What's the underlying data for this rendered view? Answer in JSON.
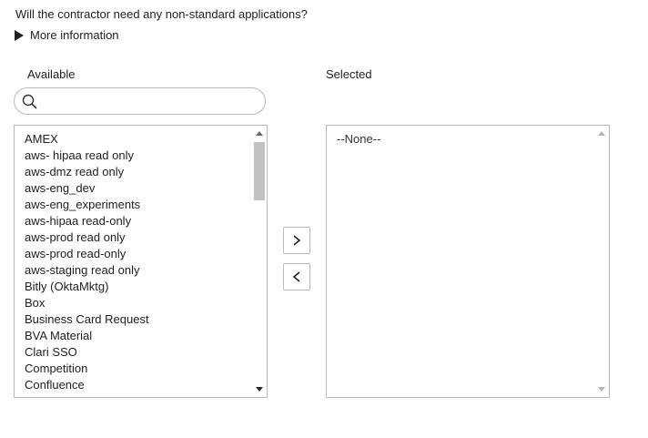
{
  "question": "Will the contractor need any non-standard applications?",
  "more_info_label": "More information",
  "available": {
    "label": "Available",
    "search_placeholder": "",
    "items": [
      "AMEX",
      "aws- hipaa read only",
      "aws-dmz read only",
      "aws-eng_dev",
      "aws-eng_experiments",
      "aws-hipaa read-only",
      "aws-prod read only",
      "aws-prod read-only",
      "aws-staging read only",
      "Bitly (OktaMktg)",
      "Box",
      "Business Card Request",
      "BVA Material",
      "Clari SSO",
      "Competition",
      "Confluence"
    ]
  },
  "selected": {
    "label": "Selected",
    "items": [
      "--None--"
    ]
  },
  "buttons": {
    "add_icon": "chevron-right-icon",
    "remove_icon": "chevron-left-icon"
  }
}
